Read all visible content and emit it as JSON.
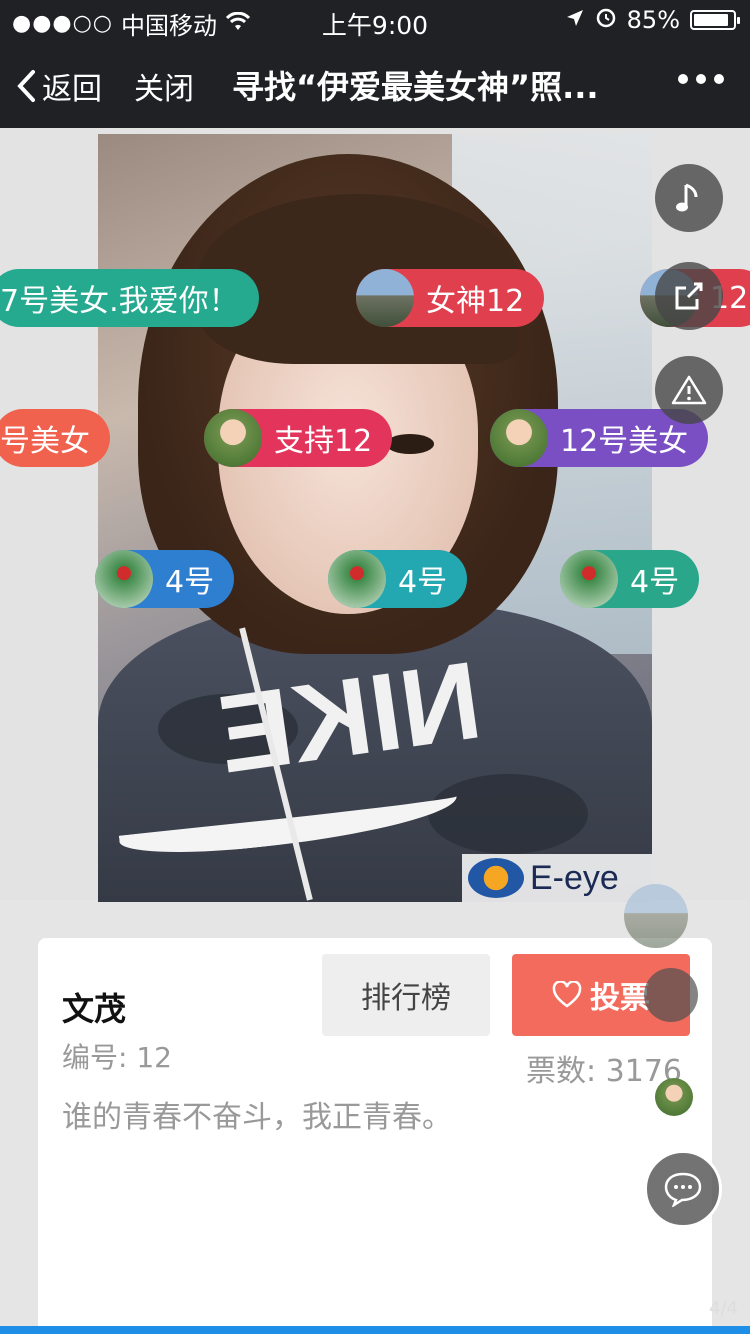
{
  "status_bar": {
    "carrier": "中国移动",
    "time": "上午9:00",
    "battery": "85%"
  },
  "nav": {
    "back_label": "返回",
    "close_label": "关闭",
    "title": "寻找“伊爱最美女神”照..."
  },
  "danmaku": [
    {
      "text": "7号美女.我爱你！",
      "color": "#25a98f"
    },
    {
      "text": "女神12",
      "color": "#e0404e",
      "avatar": "mountain-avatar"
    },
    {
      "text": "12",
      "color": "#e0404e",
      "avatar": "mountain-avatar"
    },
    {
      "text": "号美女",
      "color": "#f0614e"
    },
    {
      "text": "支持12",
      "color": "#e3355c",
      "avatar": "kid-avatar"
    },
    {
      "text": "12号美女",
      "color": "#7a4fc4",
      "avatar": "kid-avatar"
    },
    {
      "text": "4号",
      "color": "#2f7fd1",
      "avatar": "plant-avatar"
    },
    {
      "text": "4号",
      "color": "#23a7b0",
      "avatar": "plant-avatar"
    },
    {
      "text": "4号",
      "color": "#2aa68a",
      "avatar": "plant-avatar"
    }
  ],
  "watermark": {
    "text": "E-eye"
  },
  "contestant": {
    "name": "文茂",
    "number": "编号: 12",
    "slogan": "谁的青春不奋斗，我正青春。",
    "votes": "票数: 3176"
  },
  "buttons": {
    "rank": "排行榜",
    "vote": "投票"
  },
  "page_indicator": "4/4",
  "icons": [
    "music-icon",
    "share-icon",
    "report-icon",
    "chat-icon",
    "heart-icon"
  ]
}
